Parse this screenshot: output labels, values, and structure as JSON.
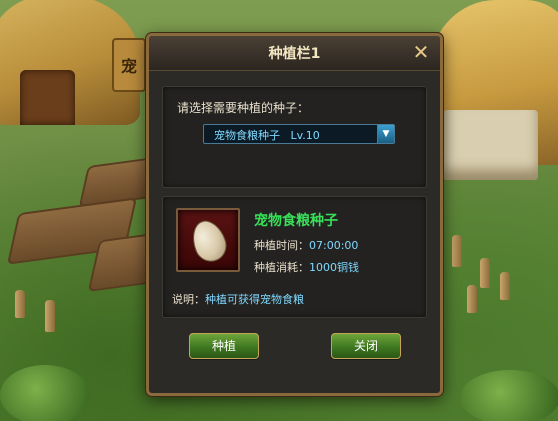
{
  "scene": {
    "sign_text": "宠"
  },
  "dialog": {
    "title": "种植栏1",
    "close_icon": "close-icon",
    "prompt": "请选择需要种植的种子：",
    "seed_select": {
      "selected": "宠物食粮种子   Lv.10",
      "arrow": "▼"
    },
    "seed": {
      "icon": "seed-icon",
      "name": "宠物食粮种子",
      "time_label": "种植时间：",
      "time_value": "07:00:00",
      "cost_label": "种植消耗：",
      "cost_value": "1000铜钱",
      "desc_label": "说明：",
      "desc_text": "种植可获得宠物食粮"
    },
    "buttons": {
      "plant": "种植",
      "close": "关闭"
    }
  },
  "colors": {
    "accent": "#7fd8ff",
    "seed_name": "#38e05a",
    "button": "#3e7720"
  }
}
